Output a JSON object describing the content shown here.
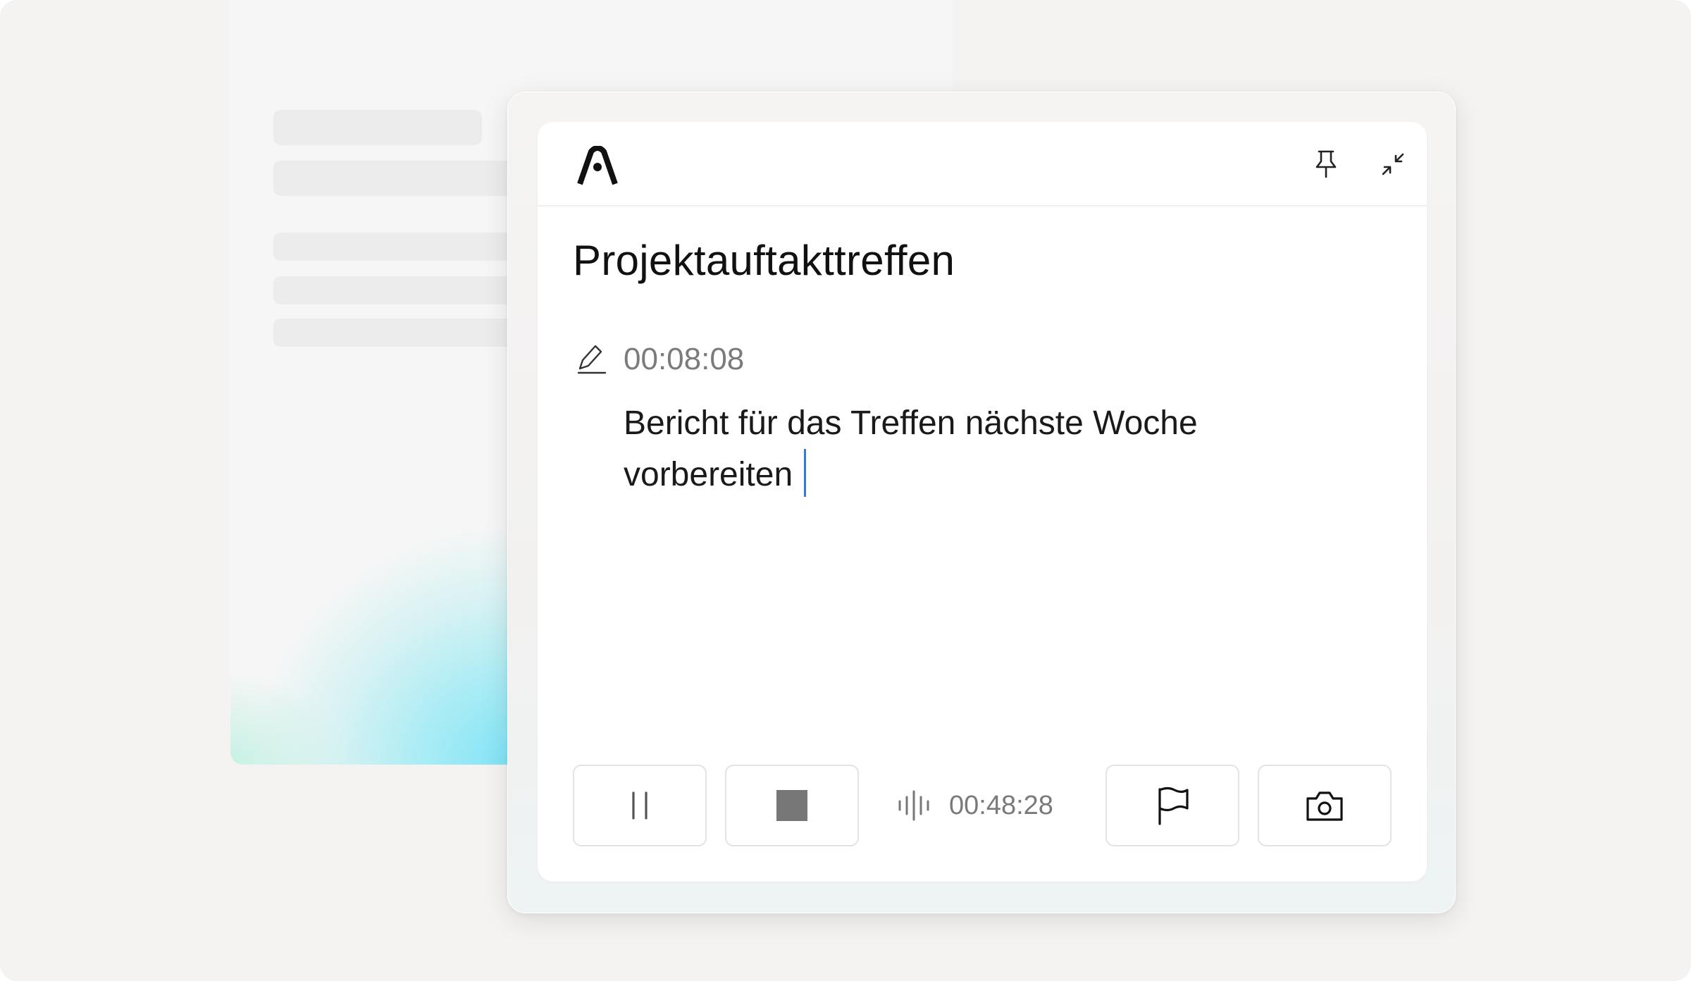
{
  "app": {
    "logo": "app-logo-icon",
    "header_actions": [
      {
        "icon": "pin-icon",
        "label": "Pin"
      },
      {
        "icon": "collapse-icon",
        "label": "Collapse"
      }
    ]
  },
  "note": {
    "title": "Projektauftakttreffen",
    "timestamp": "00:08:08",
    "timestamp_icon": "pencil-icon",
    "text": "Bericht für das Treffen nächste Woche vorbereiten"
  },
  "controls": {
    "pause_icon": "pause-icon",
    "stop_icon": "stop-icon",
    "recording_icon": "waveform-icon",
    "recording_time": "00:48:28",
    "flag_icon": "flag-icon",
    "camera_icon": "camera-icon"
  },
  "colors": {
    "caret": "#2f7be0",
    "stop_fill": "#777777",
    "glow": "#7fe3f6"
  }
}
